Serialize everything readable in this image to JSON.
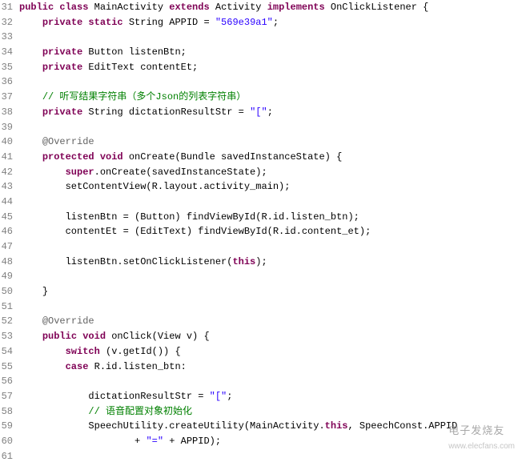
{
  "line_numbers": [
    "31",
    "32",
    "33",
    "34",
    "35",
    "36",
    "37",
    "38",
    "39",
    "40",
    "41",
    "42",
    "43",
    "44",
    "45",
    "46",
    "47",
    "48",
    "49",
    "50",
    "51",
    "52",
    "53",
    "54",
    "55",
    "56",
    "57",
    "58",
    "59",
    "60",
    "61"
  ],
  "lines": {
    "l31": {
      "kw1": "public class",
      "name": " MainActivity ",
      "kw2": "extends",
      "ext": " Activity ",
      "kw3": "implements",
      "impl": " OnClickListener {"
    },
    "l32": {
      "indent": "    ",
      "kw": "private static",
      "type": " String APPID = ",
      "str": "\"569e39a1\"",
      "end": ";"
    },
    "l33": {
      "text": ""
    },
    "l34": {
      "indent": "    ",
      "kw": "private",
      "rest": " Button listenBtn;"
    },
    "l35": {
      "indent": "    ",
      "kw": "private",
      "rest": " EditText contentEt;"
    },
    "l36": {
      "text": ""
    },
    "l37": {
      "indent": "    ",
      "cmt": "// 听写结果字符串（多个Json的列表字符串）"
    },
    "l38": {
      "indent": "    ",
      "kw": "private",
      "type": " String dictationResultStr = ",
      "str": "\"[\"",
      "end": ";"
    },
    "l39": {
      "text": ""
    },
    "l40": {
      "indent": "    ",
      "ann": "@Override"
    },
    "l41": {
      "indent": "    ",
      "kw1": "protected void",
      "name": " onCreate(Bundle savedInstanceState) {"
    },
    "l42": {
      "indent": "        ",
      "kw": "super",
      "rest": ".onCreate(savedInstanceState);"
    },
    "l43": {
      "indent": "        ",
      "text": "setContentView(R.layout.activity_main);"
    },
    "l44": {
      "text": ""
    },
    "l45": {
      "indent": "        ",
      "text": "listenBtn = (Button) findViewById(R.id.listen_btn);"
    },
    "l46": {
      "indent": "        ",
      "text": "contentEt = (EditText) findViewById(R.id.content_et);"
    },
    "l47": {
      "text": ""
    },
    "l48": {
      "indent": "        ",
      "pre": "listenBtn.setOnClickListener(",
      "kw": "this",
      "end": ");"
    },
    "l49": {
      "text": ""
    },
    "l50": {
      "indent": "    ",
      "text": "}"
    },
    "l51": {
      "text": ""
    },
    "l52": {
      "indent": "    ",
      "ann": "@Override"
    },
    "l53": {
      "indent": "    ",
      "kw1": "public void",
      "name": " onClick(View v) {"
    },
    "l54": {
      "indent": "        ",
      "kw": "switch",
      "rest": " (v.getId()) {"
    },
    "l55": {
      "indent": "        ",
      "kw": "case",
      "rest": " R.id.listen_btn:"
    },
    "l56": {
      "text": ""
    },
    "l57": {
      "indent": "            ",
      "pre": "dictationResultStr = ",
      "str": "\"[\"",
      "end": ";"
    },
    "l58": {
      "indent": "            ",
      "cmt": "// 语音配置对象初始化"
    },
    "l59": {
      "indent": "            ",
      "pre": "SpeechUtility.createUtility(MainActivity.",
      "kw": "this",
      "mid": ", SpeechConst",
      "end": ".APPID"
    },
    "l60": {
      "indent": "                    ",
      "pre": "+ ",
      "str": "\"=\"",
      "end": " + APPID);"
    },
    "l61": {
      "text": ""
    }
  },
  "watermark": {
    "brand": "电子发烧友",
    "url": "www.elecfans.com"
  }
}
